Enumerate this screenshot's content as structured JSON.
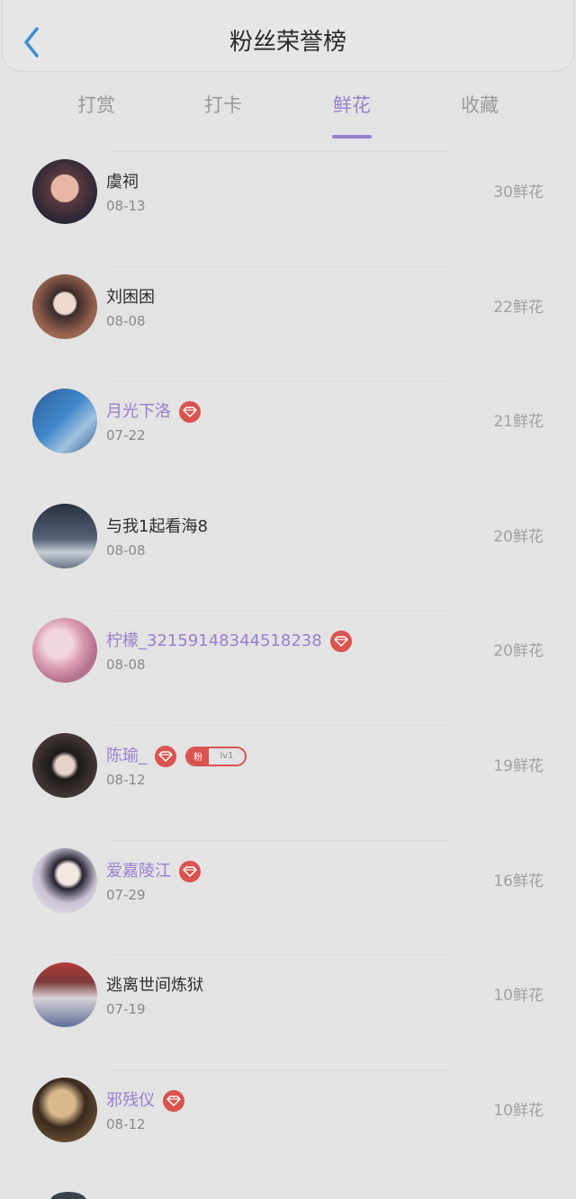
{
  "header": {
    "title": "粉丝荣誉榜"
  },
  "tabs": [
    {
      "label": "打赏",
      "active": false
    },
    {
      "label": "打卡",
      "active": false
    },
    {
      "label": "鲜花",
      "active": true
    },
    {
      "label": "收藏",
      "active": false
    }
  ],
  "fans": [
    {
      "name": "虞祠",
      "date": "08-13",
      "count": "30鲜花",
      "vip": false
    },
    {
      "name": "刘困困",
      "date": "08-08",
      "count": "22鲜花",
      "vip": false
    },
    {
      "name": "月光下洛",
      "date": "07-22",
      "count": "21鲜花",
      "vip": true
    },
    {
      "name": "与我1起看海8",
      "date": "08-08",
      "count": "20鲜花",
      "vip": false
    },
    {
      "name": "柠檬_32159148344518238",
      "date": "08-08",
      "count": "20鲜花",
      "vip": true
    },
    {
      "name": "陈瑜_",
      "date": "08-12",
      "count": "19鲜花",
      "vip": true,
      "fan_badge": {
        "label": "粉",
        "level": "lv1"
      }
    },
    {
      "name": "爱嘉陵江",
      "date": "07-29",
      "count": "16鲜花",
      "vip": true
    },
    {
      "name": "逃离世间炼狱",
      "date": "07-19",
      "count": "10鲜花",
      "vip": false
    },
    {
      "name": "邪残仪",
      "date": "08-12",
      "count": "10鲜花",
      "vip": true
    }
  ],
  "colors": {
    "accent": "#9b7fcf",
    "vip_badge": "#d9534f",
    "back_icon": "#3b8fd6"
  }
}
